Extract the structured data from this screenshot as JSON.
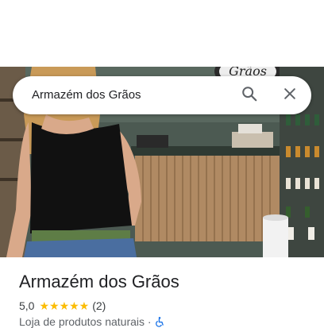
{
  "search": {
    "query": "Armazém dos Grãos",
    "search_icon": "search-icon",
    "close_icon": "close-icon"
  },
  "photo": {
    "sign_text": "Grãos"
  },
  "place": {
    "name": "Armazém dos Grãos",
    "rating": "5,0",
    "stars": "★★★★★",
    "star_count": 5,
    "review_count": "(2)",
    "category": "Loja de produtos naturais",
    "separator": "·",
    "accessibility_icon": "accessible-icon"
  },
  "colors": {
    "star": "#fbbc04",
    "accent": "#1a73e8",
    "text_primary": "#202124",
    "text_secondary": "#5f6368"
  }
}
